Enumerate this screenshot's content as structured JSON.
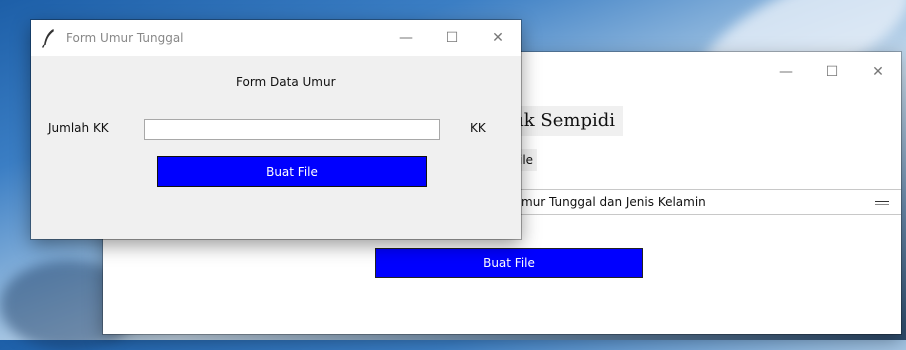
{
  "back_window": {
    "heading_text": "ık Sempidi",
    "sub_text": "ile",
    "combo_text": "mur Tunggal dan Jenis Kelamin",
    "button_label": "Buat File",
    "minimize_glyph": "—",
    "maximize_glyph": "☐",
    "close_glyph": "✕"
  },
  "front_window": {
    "title": "Form Umur Tunggal",
    "heading": "Form Data Umur",
    "jumlah_label": "Jumlah KK",
    "jumlah_value": "",
    "jumlah_placeholder": "",
    "unit_label": "KK",
    "button_label": "Buat File",
    "minimize_glyph": "—",
    "maximize_glyph": "☐",
    "close_glyph": "✕"
  },
  "colors": {
    "button_blue": "#0000ff",
    "window_bg": "#f0f0f0"
  },
  "icons": {
    "app_icon": "feather-icon"
  }
}
